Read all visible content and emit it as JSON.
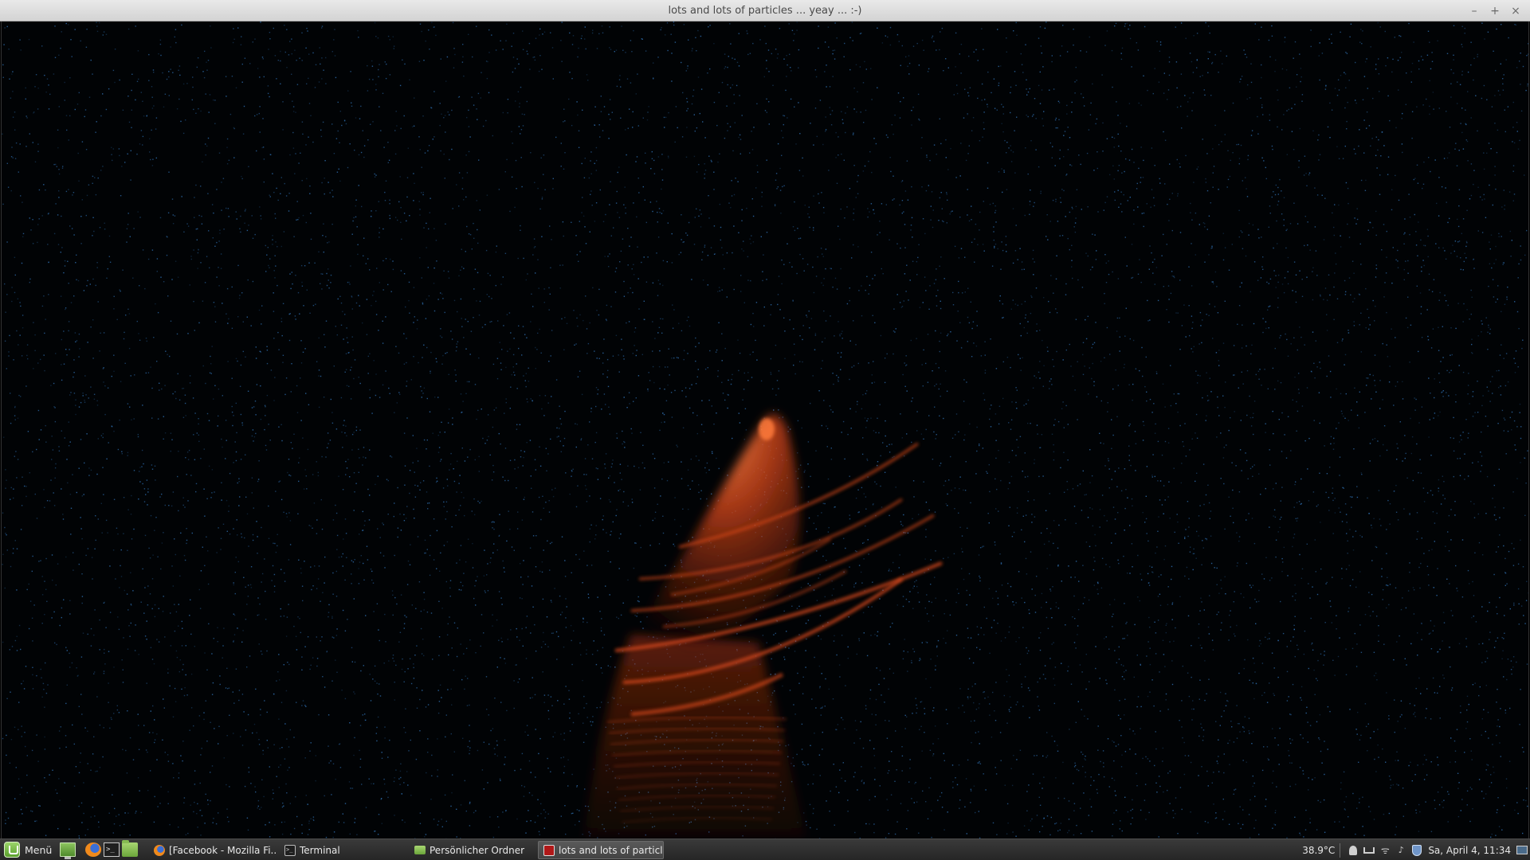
{
  "window": {
    "title": "lots and lots of particles ... yeay ... :-)",
    "controls": {
      "minimize_icon": "–",
      "maximize_icon": "+",
      "close_icon": "×"
    }
  },
  "scene": {
    "background_color": "#010305",
    "star_color": "#2f6fb0",
    "plume_color": "#d9481a",
    "plume_highlight_color": "#ff7a3a"
  },
  "taskbar": {
    "menu_label": "Menü",
    "tasks": [
      {
        "label": "[Facebook - Mozilla Fi...",
        "icon": "firefox-icon"
      },
      {
        "label": "Terminal",
        "icon": "terminal-icon"
      },
      {
        "label": "Persönlicher Ordner",
        "icon": "folder-icon"
      },
      {
        "label": "lots and lots of particl...",
        "icon": "app-icon",
        "active": true
      }
    ],
    "tray": {
      "temperature": "38.9°C",
      "datetime": "Sa, April  4, 11:34",
      "terminal_glyph": ">_",
      "wifi_glyph": "ᯤ",
      "volume_glyph": "♪"
    }
  }
}
